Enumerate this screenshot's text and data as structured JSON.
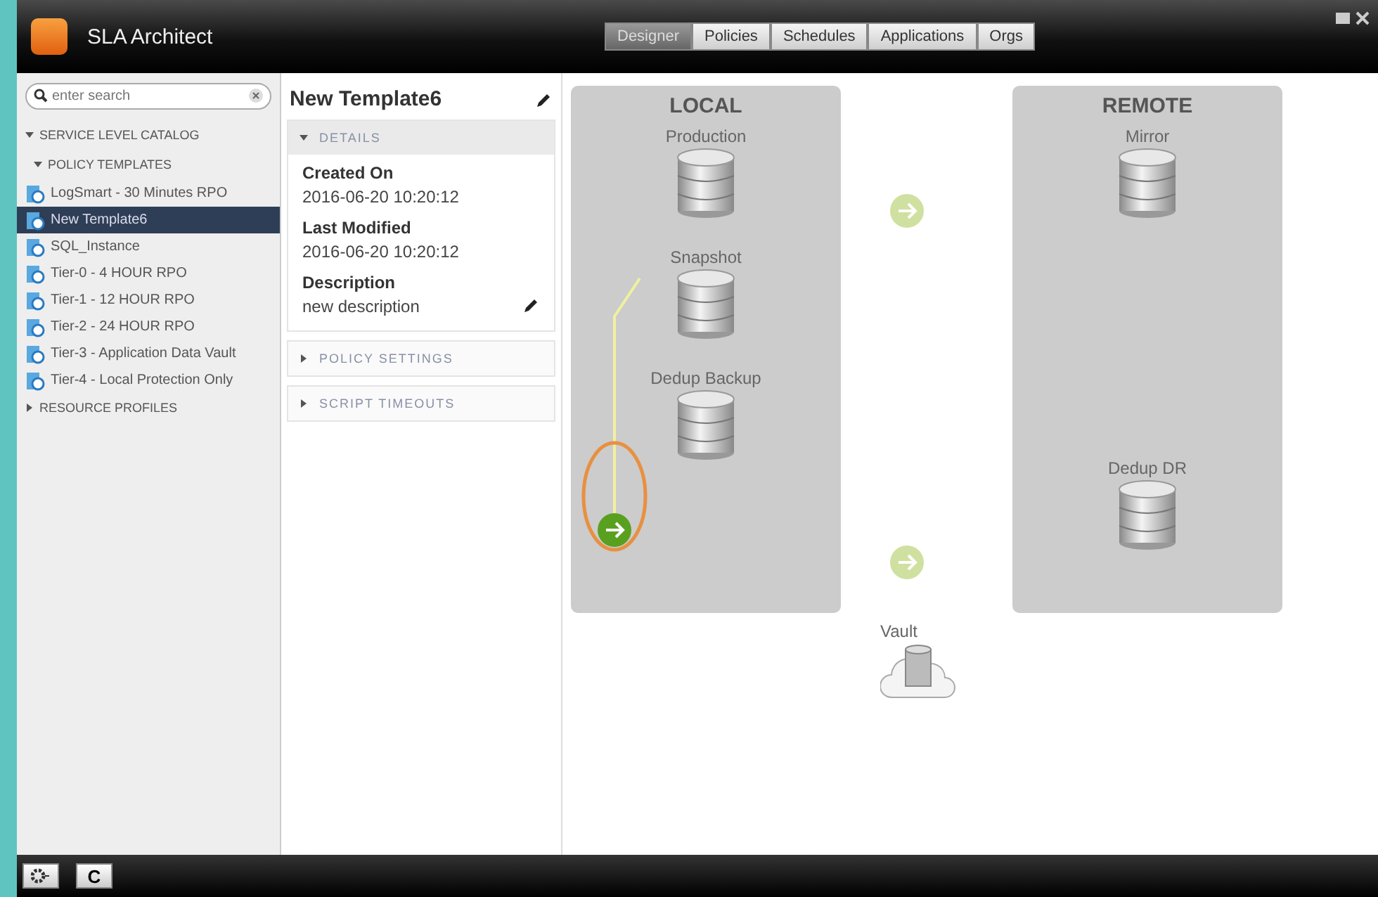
{
  "app": {
    "title": "SLA Architect"
  },
  "tabs": [
    {
      "label": "Designer",
      "selected": true
    },
    {
      "label": "Policies",
      "selected": false
    },
    {
      "label": "Schedules",
      "selected": false
    },
    {
      "label": "Applications",
      "selected": false
    },
    {
      "label": "Orgs",
      "selected": false
    }
  ],
  "search": {
    "placeholder": "enter search"
  },
  "tree": [
    {
      "label": "SERVICE LEVEL CATALOG",
      "expanded": true,
      "children": [
        {
          "label": "POLICY TEMPLATES",
          "expanded": true,
          "children": [
            {
              "label": "LogSmart - 30 Minutes RPO",
              "selected": false
            },
            {
              "label": "New Template6",
              "selected": true
            },
            {
              "label": "SQL_Instance",
              "selected": false
            },
            {
              "label": "Tier-0 - 4 HOUR RPO",
              "selected": false
            },
            {
              "label": "Tier-1 - 12 HOUR RPO",
              "selected": false
            },
            {
              "label": "Tier-2 - 24 HOUR RPO",
              "selected": false
            },
            {
              "label": "Tier-3 - Application Data Vault",
              "selected": false
            },
            {
              "label": "Tier-4 - Local Protection Only",
              "selected": false
            }
          ]
        }
      ]
    },
    {
      "label": "RESOURCE PROFILES",
      "expanded": false
    }
  ],
  "details": {
    "title": "New Template6",
    "sections": [
      {
        "label": "DETAILS",
        "expanded": true,
        "fields": [
          {
            "label": "Created On",
            "value": "2016-06-20 10:20:12",
            "editable": false
          },
          {
            "label": "Last Modified",
            "value": "2016-06-20 10:20:12",
            "editable": false
          },
          {
            "label": "Description",
            "value": "new description",
            "editable": true
          }
        ]
      },
      {
        "label": "POLICY SETTINGS",
        "expanded": false
      },
      {
        "label": "SCRIPT TIMEOUTS",
        "expanded": false
      }
    ]
  },
  "canvas": {
    "zones": [
      {
        "title": "LOCAL",
        "nodes": [
          "Production",
          "Snapshot",
          "Dedup Backup"
        ]
      },
      {
        "title": "REMOTE",
        "nodes": [
          "Mirror",
          "Dedup DR"
        ]
      }
    ],
    "links": [
      {
        "active": false
      },
      {
        "active": false
      },
      {
        "active": true
      }
    ],
    "vault": {
      "label": "Vault"
    }
  },
  "footer": {
    "refresh": "C"
  }
}
